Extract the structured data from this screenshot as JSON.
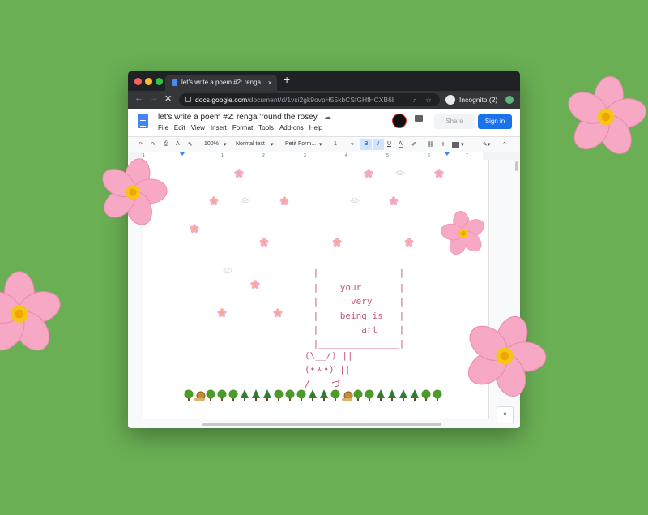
{
  "browser": {
    "tab_title": "let's write a poem #2: renga 'round the rosey",
    "tab_close": "×",
    "new_tab": "+",
    "nav_back": "←",
    "nav_forward": "→",
    "nav_reload": "✕",
    "url_domain": "docs.google.com",
    "url_path": "/document/d/1vsi2gk9ovpH55kbCSfGHfHCXB6b9...",
    "incognito_label": "Incognito (2)"
  },
  "doc": {
    "title": "let's write a poem #2: renga 'round the rosey",
    "menu": [
      "File",
      "Edit",
      "View",
      "Insert",
      "Format",
      "Tools",
      "Add-ons",
      "Help"
    ],
    "share_label": "Share",
    "signin_label": "Sign in"
  },
  "toolbar": {
    "zoom": "100%",
    "style": "Normal text",
    "font": "Petit Form...",
    "size": "1",
    "bold": "B",
    "italic": "I",
    "underline": "U",
    "text_color": "A"
  },
  "ruler_numbers": [
    "1",
    "1",
    "2",
    "3",
    "4",
    "5",
    "6",
    "7"
  ],
  "poem": {
    "box_top": "  _______________",
    "line1": " |               |",
    "line2": " |    your       |",
    "line3": " |      very     |",
    "line4": " |    being is   |",
    "line5": " |        art    |",
    "box_bottom": " |_______________|",
    "bunny1": "(\\__/) ||",
    "bunny2": "(•ㅅ•) ||",
    "bunny3": "/    づ"
  },
  "colors": {
    "background": "#6aaf54",
    "poem_text": "#c6577a",
    "blossom_petal": "#f7a8c4",
    "blossom_center": "#f5c518"
  },
  "icons": [
    "cherry-blossom-icon",
    "cloud-icon",
    "tree-icon",
    "evergreen-tree-icon",
    "snail-icon"
  ]
}
